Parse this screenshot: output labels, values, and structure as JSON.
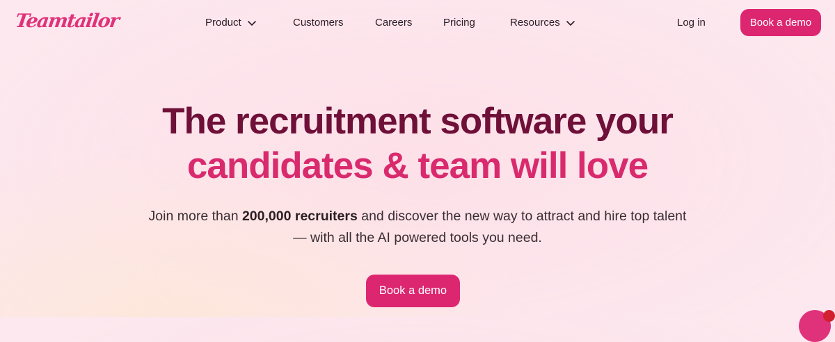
{
  "brand": {
    "logo_text": "Teamtailor",
    "accent_color": "#dc2670",
    "heading_dark_color": "#6e1038",
    "heading_pink_color": "#d92a6e"
  },
  "nav": {
    "product": "Product",
    "customers": "Customers",
    "careers": "Careers",
    "pricing": "Pricing",
    "resources": "Resources",
    "login": "Log in",
    "cta": "Book a demo"
  },
  "hero": {
    "title_line_1": "The recruitment software your",
    "title_line_2": "candidates & team will love",
    "subtitle_before": "Join more than ",
    "subtitle_bold": "200,000 recruiters",
    "subtitle_after": " and discover the new way to attract and hire top talent",
    "subtitle_line_2": "— with all the AI powered tools you need.",
    "cta": "Book a demo"
  },
  "icons": {
    "dropdown": "chevron-down-icon",
    "chat": "chat-icon"
  }
}
